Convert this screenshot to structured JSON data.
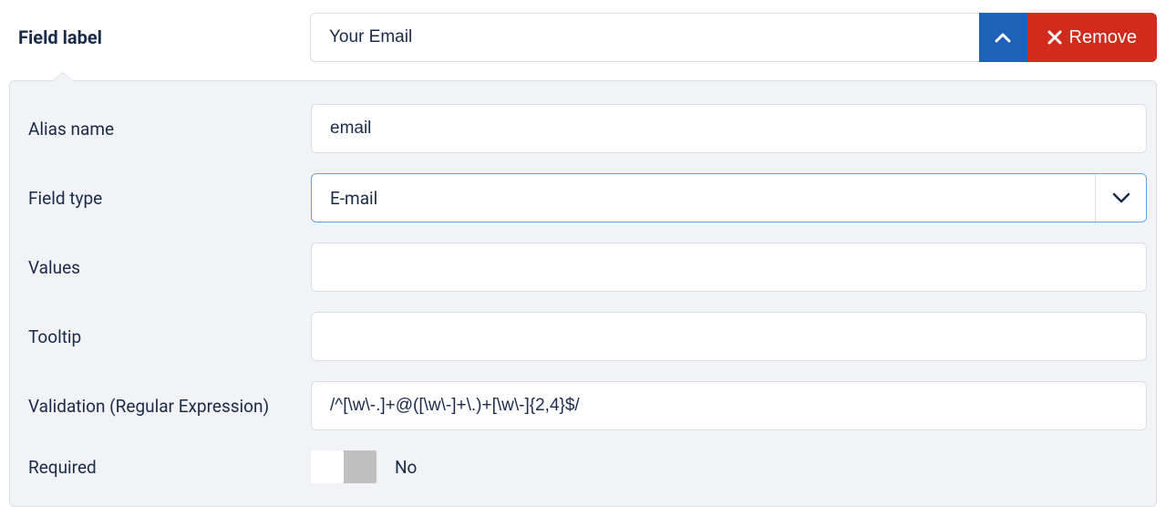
{
  "header": {
    "field_label_text": "Field label",
    "field_label_value": "Your Email",
    "remove_label": "Remove"
  },
  "form": {
    "alias": {
      "label": "Alias name",
      "value": "email"
    },
    "field_type": {
      "label": "Field type",
      "value": "E-mail"
    },
    "values": {
      "label": "Values",
      "value": ""
    },
    "tooltip": {
      "label": "Tooltip",
      "value": ""
    },
    "validation": {
      "label": "Validation (Regular Expression)",
      "value": "/^[\\w\\-.]+@([\\w\\-]+\\.)+[\\w\\-]{2,4}$/"
    },
    "required": {
      "label": "Required",
      "state_label": "No"
    }
  }
}
